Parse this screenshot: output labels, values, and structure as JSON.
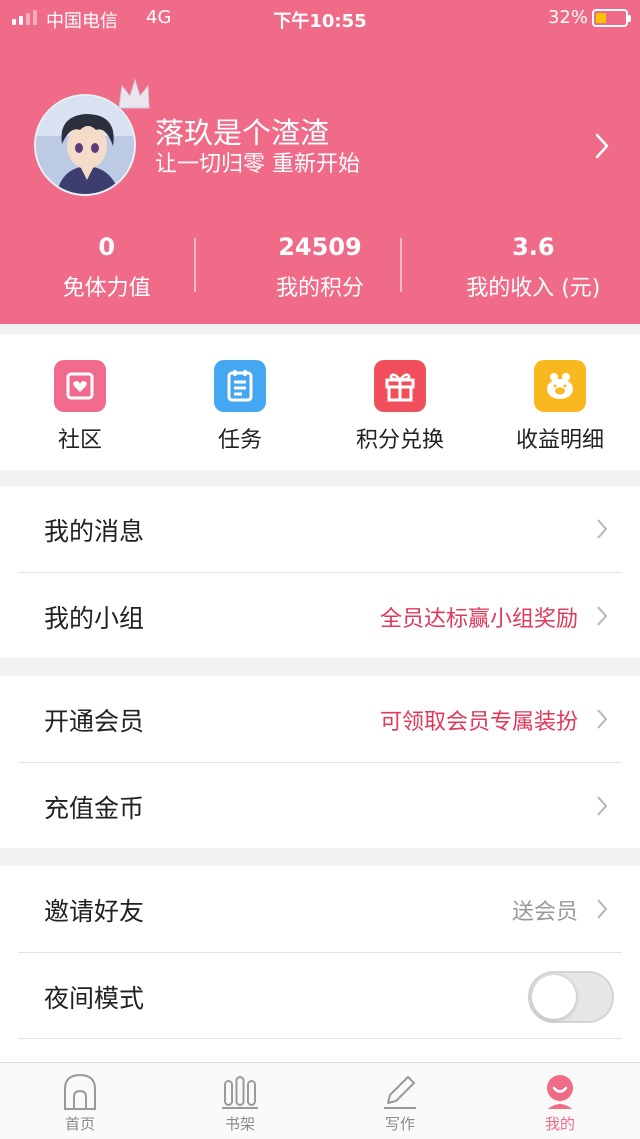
{
  "status_bar": {
    "carrier": "中国电信",
    "network": "4G",
    "time": "下午10:55",
    "battery": "32%"
  },
  "profile": {
    "nickname": "落玖是个渣渣",
    "bio": "让一切归零 重新开始"
  },
  "stats": [
    {
      "value": "0",
      "label": "免体力值"
    },
    {
      "value": "24509",
      "label": "我的积分"
    },
    {
      "value": "3.6",
      "label": "我的收入 (元)"
    }
  ],
  "quick_menu": [
    {
      "label": "社区",
      "icon": "community-icon",
      "color": "#f36a8f"
    },
    {
      "label": "任务",
      "icon": "task-icon",
      "color": "#45a6f2"
    },
    {
      "label": "积分兑换",
      "icon": "gift-icon",
      "color": "#f04f5c"
    },
    {
      "label": "收益明细",
      "icon": "piggy-bank-icon",
      "color": "#f9b720"
    }
  ],
  "menu": {
    "messages": {
      "label": "我的消息"
    },
    "group": {
      "label": "我的小组",
      "extra": "全员达标赢小组奖励"
    },
    "vip": {
      "label": "开通会员",
      "extra": "可领取会员专属装扮"
    },
    "recharge": {
      "label": "充值金币"
    },
    "invite": {
      "label": "邀请好友",
      "extra": "送会员"
    },
    "night_mode": {
      "label": "夜间模式",
      "enabled": false
    }
  },
  "tabs": [
    {
      "label": "首页",
      "icon": "home-icon"
    },
    {
      "label": "书架",
      "icon": "bookshelf-icon"
    },
    {
      "label": "写作",
      "icon": "pencil-icon"
    },
    {
      "label": "我的",
      "icon": "profile-icon",
      "active": true
    }
  ],
  "colors": {
    "brand": "#f06b88",
    "accent_red": "#e0395a"
  }
}
